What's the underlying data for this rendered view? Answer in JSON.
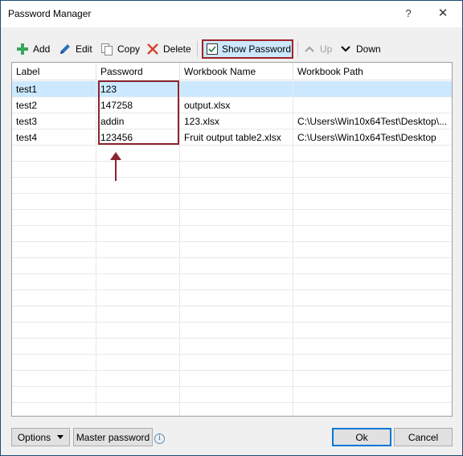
{
  "window": {
    "title": "Password Manager",
    "help": "?",
    "close": "✕"
  },
  "toolbar": {
    "add": "Add",
    "edit": "Edit",
    "copy": "Copy",
    "delete": "Delete",
    "show_password": "Show Password",
    "show_password_checked": true,
    "up": "Up",
    "down": "Down"
  },
  "table": {
    "columns": [
      "Label",
      "Password",
      "Workbook Name",
      "Workbook Path"
    ],
    "rows": [
      {
        "label": "test1",
        "password": "123",
        "workbook": "",
        "path": ""
      },
      {
        "label": "test2",
        "password": "147258",
        "workbook": "output.xlsx",
        "path": ""
      },
      {
        "label": "test3",
        "password": "addin",
        "workbook": "123.xlsx",
        "path": "C:\\Users\\Win10x64Test\\Desktop\\..."
      },
      {
        "label": "test4",
        "password": "123456",
        "workbook": "Fruit output table2.xlsx",
        "path": "C:\\Users\\Win10x64Test\\Desktop"
      }
    ]
  },
  "footer": {
    "options": "Options",
    "master_password": "Master password",
    "info": "i",
    "ok": "Ok",
    "cancel": "Cancel"
  },
  "colors": {
    "accent": "#0078d7",
    "selection": "#cce8ff",
    "highlight": "#8b2430",
    "add_icon": "#3aa55d",
    "delete_icon": "#d9432f"
  }
}
